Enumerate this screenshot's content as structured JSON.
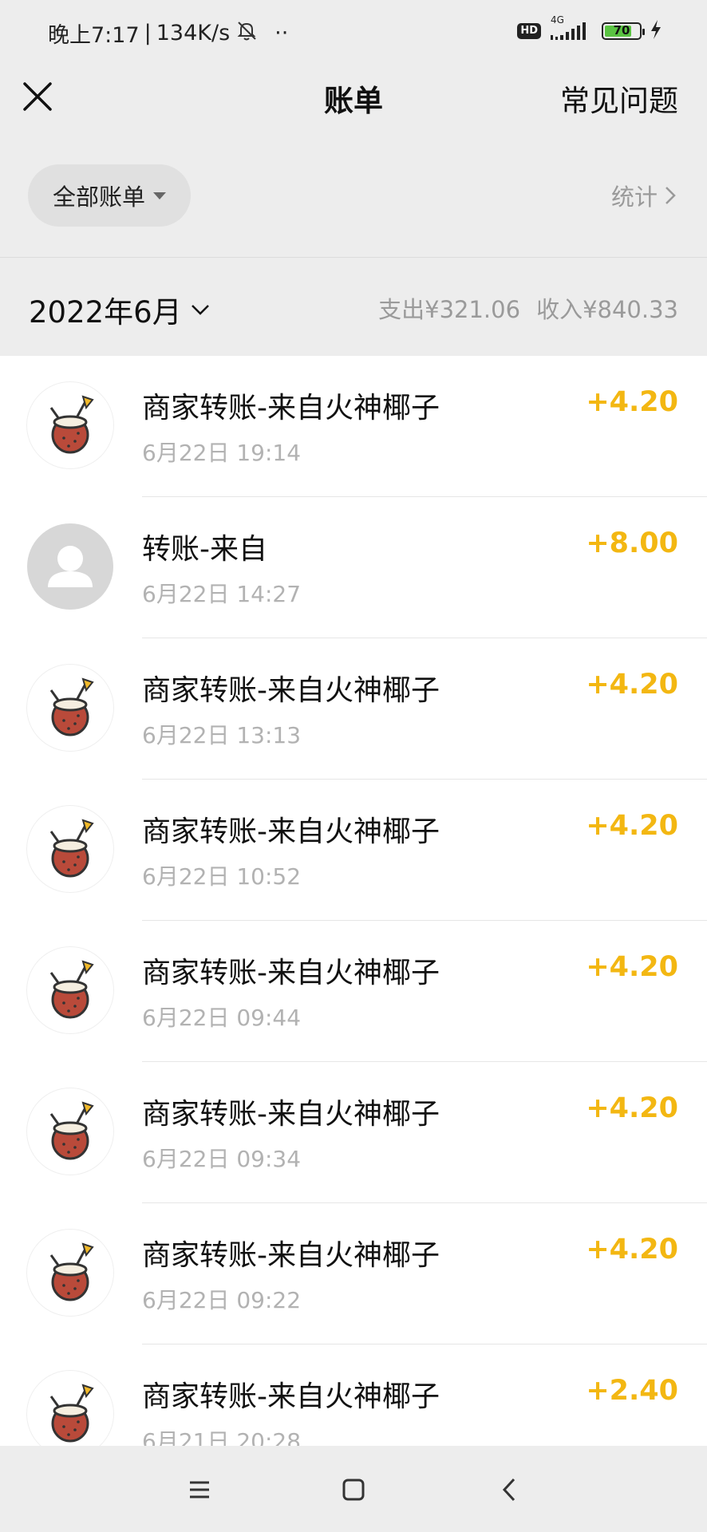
{
  "status_bar": {
    "time": "晚上7:17",
    "net_speed": "134K/s",
    "dots": "··",
    "hd": "HD",
    "network": "4G",
    "battery": "70"
  },
  "nav": {
    "title": "账单",
    "faq": "常见问题"
  },
  "filter": {
    "label": "全部账单",
    "stats": "统计"
  },
  "month": {
    "label": "2022年6月",
    "expense": "支出¥321.06",
    "income": "收入¥840.33"
  },
  "transactions": [
    {
      "title": "商家转账-来自火神椰子",
      "time": "6月22日 19:14",
      "amount": "+4.20",
      "avatar": "coconut-icon"
    },
    {
      "title": "转账-来自",
      "time": "6月22日 14:27",
      "amount": "+8.00",
      "avatar": "person-icon"
    },
    {
      "title": "商家转账-来自火神椰子",
      "time": "6月22日 13:13",
      "amount": "+4.20",
      "avatar": "coconut-icon"
    },
    {
      "title": "商家转账-来自火神椰子",
      "time": "6月22日 10:52",
      "amount": "+4.20",
      "avatar": "coconut-icon"
    },
    {
      "title": "商家转账-来自火神椰子",
      "time": "6月22日 09:44",
      "amount": "+4.20",
      "avatar": "coconut-icon"
    },
    {
      "title": "商家转账-来自火神椰子",
      "time": "6月22日 09:34",
      "amount": "+4.20",
      "avatar": "coconut-icon"
    },
    {
      "title": "商家转账-来自火神椰子",
      "time": "6月22日 09:22",
      "amount": "+4.20",
      "avatar": "coconut-icon"
    },
    {
      "title": "商家转账-来自火神椰子",
      "time": "6月21日 20:28",
      "amount": "+2.40",
      "avatar": "coconut-icon"
    }
  ],
  "colors": {
    "income_amount": "#f3b712",
    "background": "#ededed",
    "list_background": "#ffffff"
  }
}
